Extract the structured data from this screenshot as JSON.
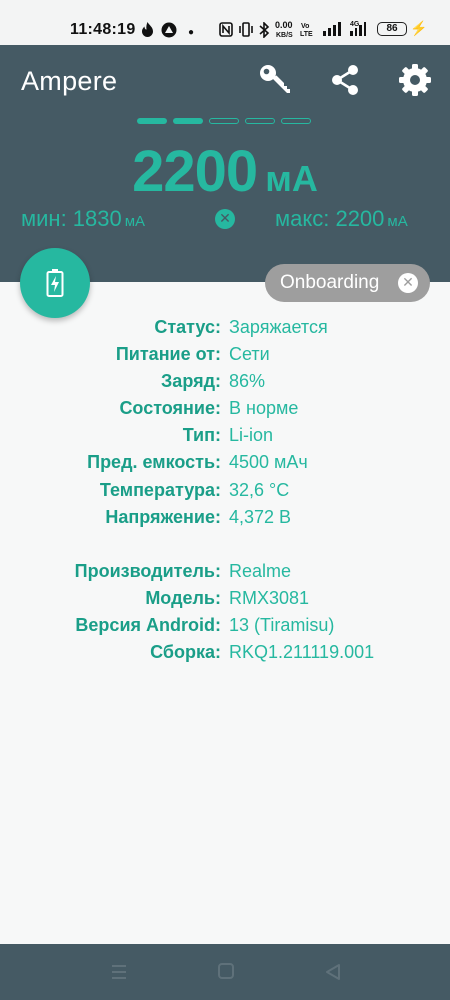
{
  "status_bar": {
    "time": "11:48:19",
    "speed_value": "0.00",
    "speed_unit": "KB/S",
    "volte": "Vo",
    "volte2": "LTE",
    "network": "4G",
    "battery": "86"
  },
  "header": {
    "app_title": "Ampere",
    "current_value": "2200",
    "current_unit": "мА",
    "min_label": "мин: 1830",
    "min_unit": "мА",
    "max_label": "макс: 2200",
    "max_unit": "мА",
    "page_dots": {
      "total": 5,
      "active": 2
    }
  },
  "chip": {
    "label": "Onboarding"
  },
  "battery_info": [
    {
      "key": "Статус:",
      "value": "Заряжается"
    },
    {
      "key": "Питание от:",
      "value": "Сети"
    },
    {
      "key": "Заряд:",
      "value": "86%"
    },
    {
      "key": "Состояние:",
      "value": "В норме"
    },
    {
      "key": "Тип:",
      "value": "Li-ion"
    },
    {
      "key": "Пред. емкость:",
      "value": "4500 мАч"
    },
    {
      "key": "Температура:",
      "value": "32,6 °C"
    },
    {
      "key": "Напряжение:",
      "value": "4,372 В"
    }
  ],
  "device_info": [
    {
      "key": "Производитель:",
      "value": "Realme"
    },
    {
      "key": "Модель:",
      "value": "RMX3081"
    },
    {
      "key": "Версия Android:",
      "value": "13 (Tiramisu)"
    },
    {
      "key": "Сборка:",
      "value": "RKQ1.211119.001"
    }
  ],
  "colors": {
    "accent": "#26b8a0",
    "header_bg": "#455a64",
    "chip_bg": "#9e9e9e",
    "page_bg": "#f7f8f8"
  },
  "icons": [
    "key-icon",
    "share-icon",
    "settings-icon",
    "battery-charging-icon",
    "close-icon",
    "menu-icon",
    "home-icon",
    "back-icon"
  ]
}
